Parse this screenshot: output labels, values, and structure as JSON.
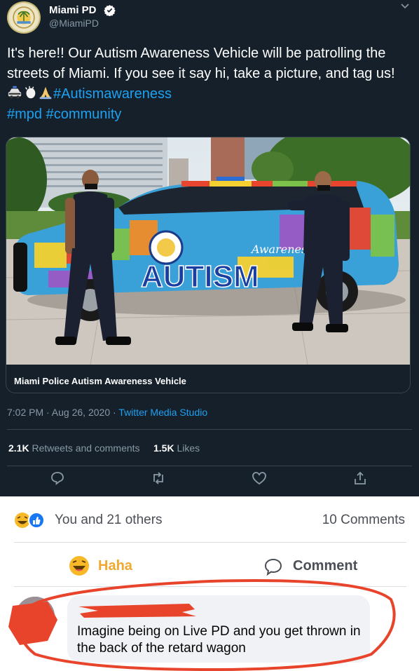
{
  "tweet": {
    "author_name": "Miami PD",
    "author_handle": "@MiamiPD",
    "text_main": "It's here!! Our Autism Awareness Vehicle will be patrolling the streets of Miami. If you see it say hi, take a picture, and tag us!",
    "hashtag_1": "#Autismawareness",
    "hashtag_2": "#mpd",
    "hashtag_3": "#community",
    "vehicle_lettering": "AUTISM",
    "vehicle_lettering_script": "Awareness",
    "media_caption": "Miami Police Autism Awareness Vehicle",
    "time": "7:02 PM · Aug 26, 2020 ·",
    "source": "Twitter Media Studio",
    "retweets_count": "2.1K",
    "retweets_label": "Retweets and comments",
    "likes_count": "1.5K",
    "likes_label": "Likes"
  },
  "facebook": {
    "reactions_text": "You and 21 others",
    "comments_count": "10 Comments",
    "haha_label": "Haha",
    "comment_label": "Comment",
    "comment_text": "Imagine being on Live PD and you get thrown in the back of the retard wagon"
  },
  "colors": {
    "tweet_background": "#15202b",
    "link_blue": "#1da1f2",
    "secondary_text": "#8899a6",
    "haha_yellow": "#f0a830",
    "annotation_red": "#e8432b"
  }
}
